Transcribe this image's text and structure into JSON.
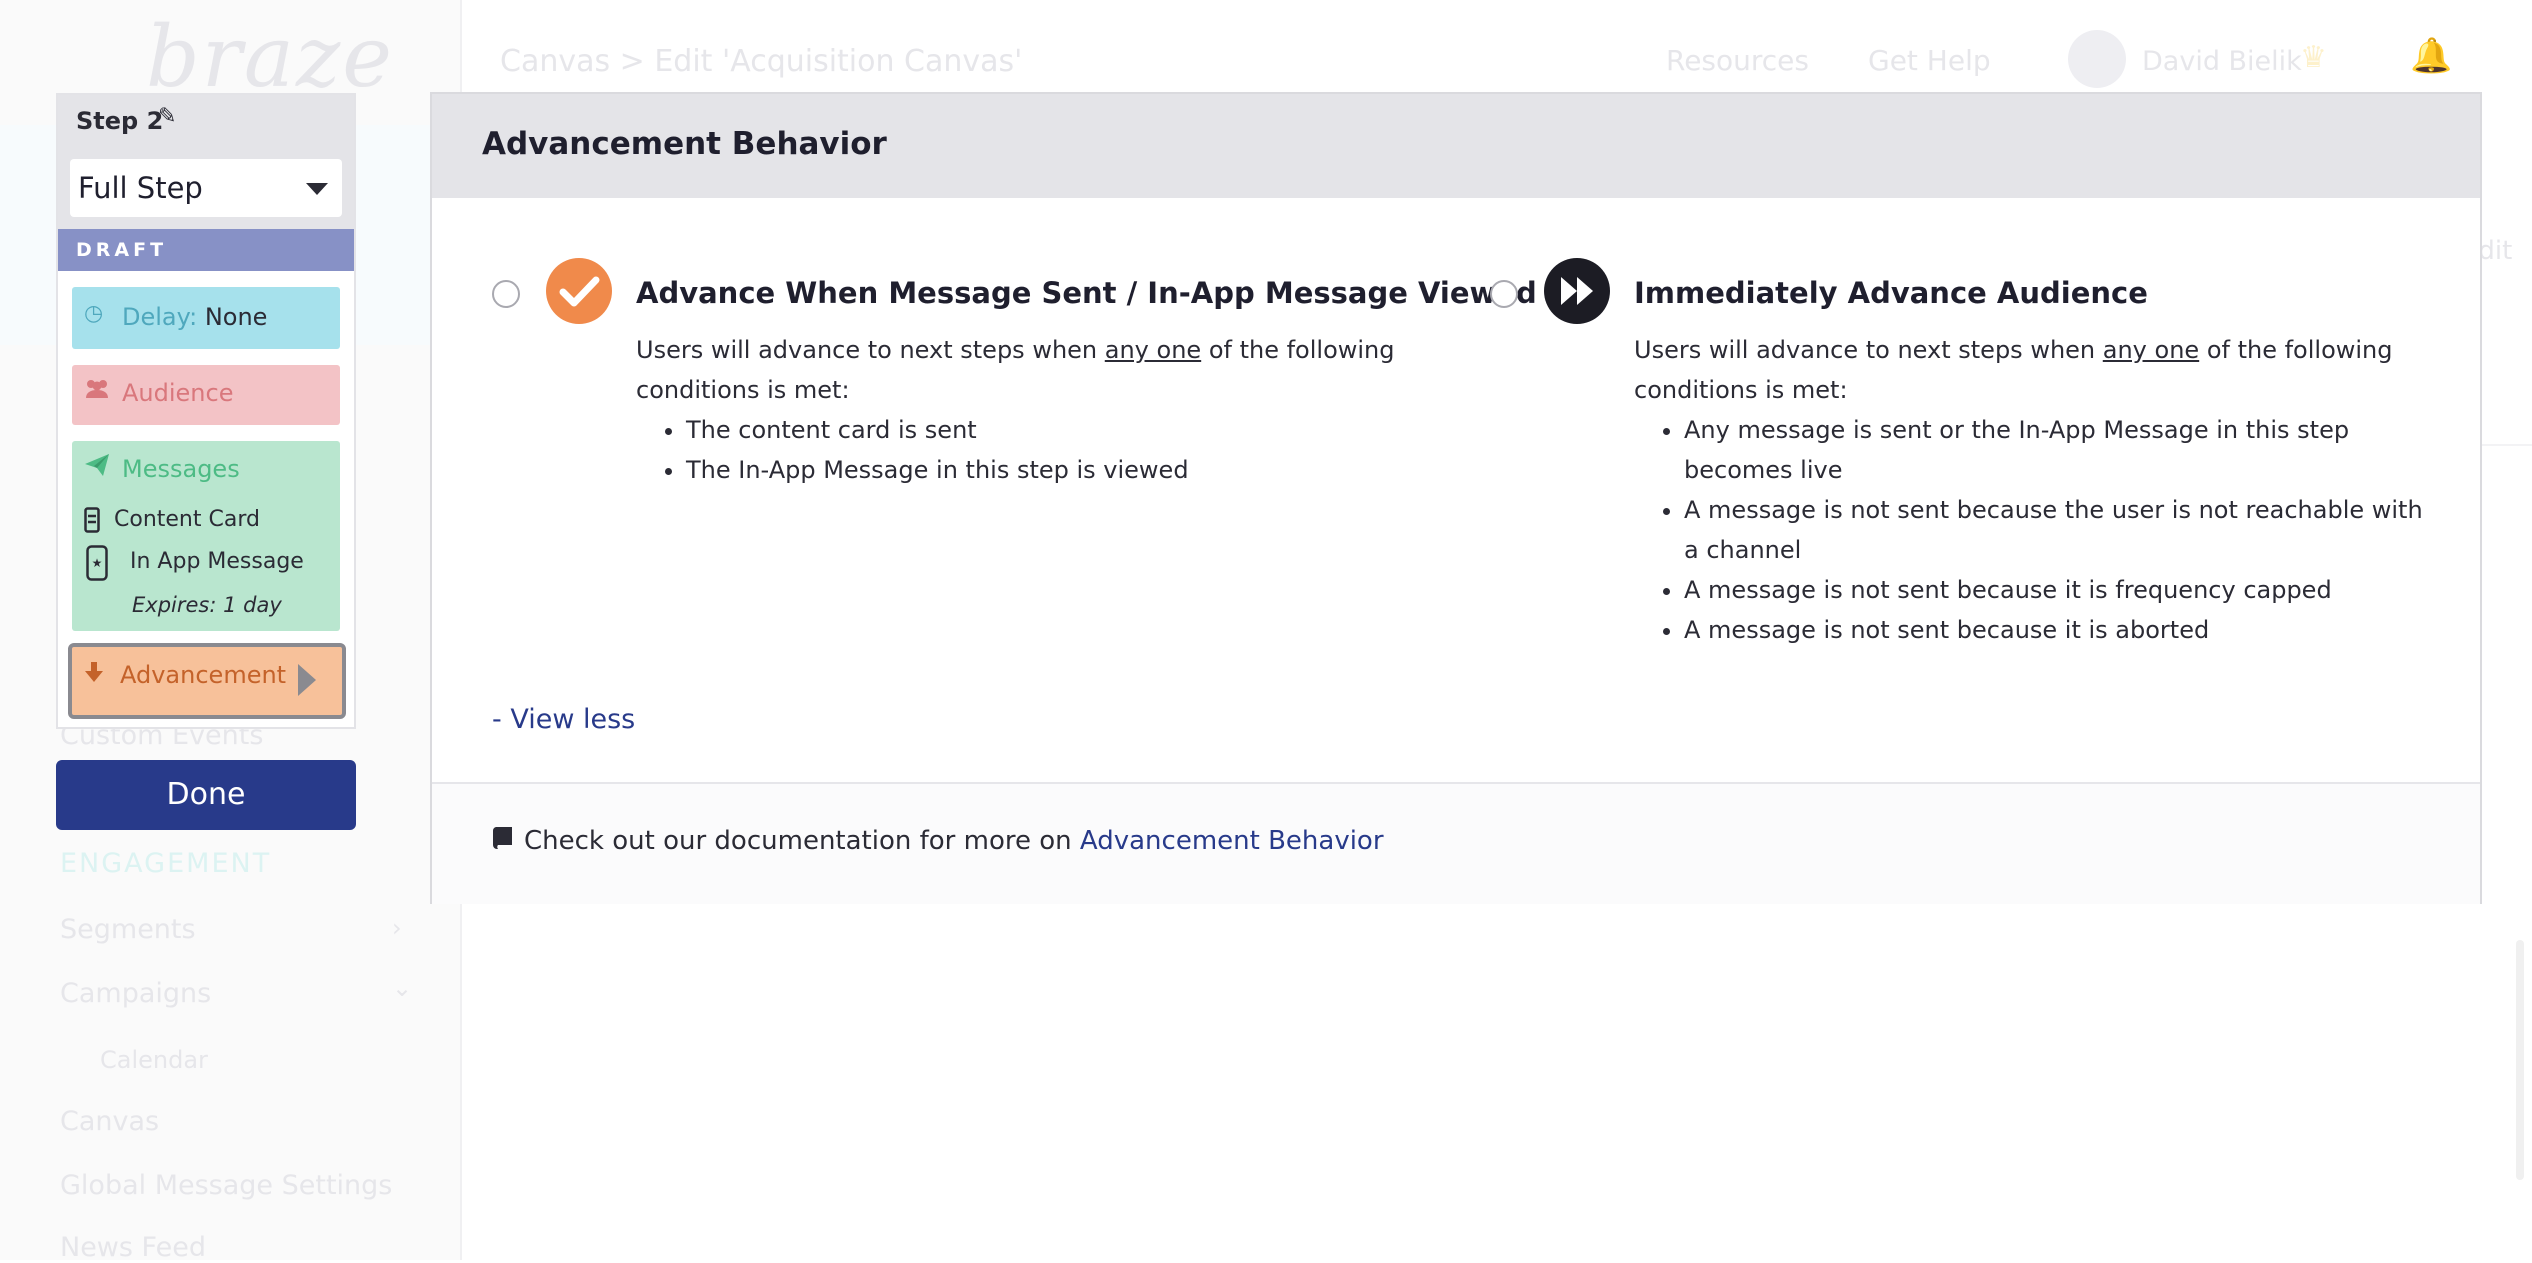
{
  "background": {
    "logo": "braze",
    "breadcrumb": "Canvas > Edit 'Acquisition Canvas'",
    "header_links": [
      "Resources",
      "Get Help"
    ],
    "user_name": "David Bielik",
    "edit_label": "Edit",
    "nav": {
      "custom_events": "Custom Events",
      "engagement_heading": "ENGAGEMENT",
      "segments": "Segments",
      "campaigns": "Campaigns",
      "calendar": "Calendar",
      "canvas": "Canvas",
      "global_message_settings": "Global Message Settings",
      "news_feed": "News Feed"
    }
  },
  "step_card": {
    "title": "Step 2",
    "step_type": "Full Step",
    "status": "DRAFT",
    "delay": {
      "label": "Delay:",
      "value": "None"
    },
    "audience": {
      "label": "Audience"
    },
    "messages": {
      "label": "Messages",
      "items": [
        "Content Card",
        "In App Message"
      ],
      "expires": "Expires: 1 day"
    },
    "advancement": {
      "label": "Advancement"
    },
    "done_label": "Done"
  },
  "modal": {
    "title": "Advancement Behavior",
    "options": [
      {
        "title": "Advance When Message Sent / In-App Message Viewed",
        "desc_pre": "Users will advance to next steps when ",
        "desc_emph": "any one",
        "desc_post": " of the following conditions is met:",
        "bullets": [
          "The content card is sent",
          "The In-App Message in this step is viewed"
        ],
        "selected": false
      },
      {
        "title": "Immediately Advance Audience",
        "desc_pre": "Users will advance to next steps when ",
        "desc_emph": "any one",
        "desc_post": " of the following conditions is met:",
        "bullets": [
          "Any message is sent or the In-App Message in this step becomes live",
          "A message is not sent because the user is not reachable with a channel",
          "A message is not sent because it is frequency capped",
          "A message is not sent because it is aborted"
        ],
        "selected": false
      }
    ],
    "view_less": "- View less",
    "footer_text": "Check out our documentation for more on ",
    "footer_link": "Advancement Behavior"
  },
  "icons": {
    "pencil": "pencil-icon",
    "clock": "clock-icon",
    "users": "users-icon",
    "paper_plane": "paper-plane-icon",
    "arrow_down": "arrow-down-icon",
    "check": "check-icon",
    "fast_forward": "fast-forward-icon",
    "book": "book-icon"
  },
  "colors": {
    "primary": "#283a8a",
    "draft": "#8791c6",
    "delay": "#a6e1ec",
    "audience": "#f3c3c6",
    "messages": "#b9e6cf",
    "advancement": "#f7c19a",
    "check_badge": "#f08a4b"
  }
}
